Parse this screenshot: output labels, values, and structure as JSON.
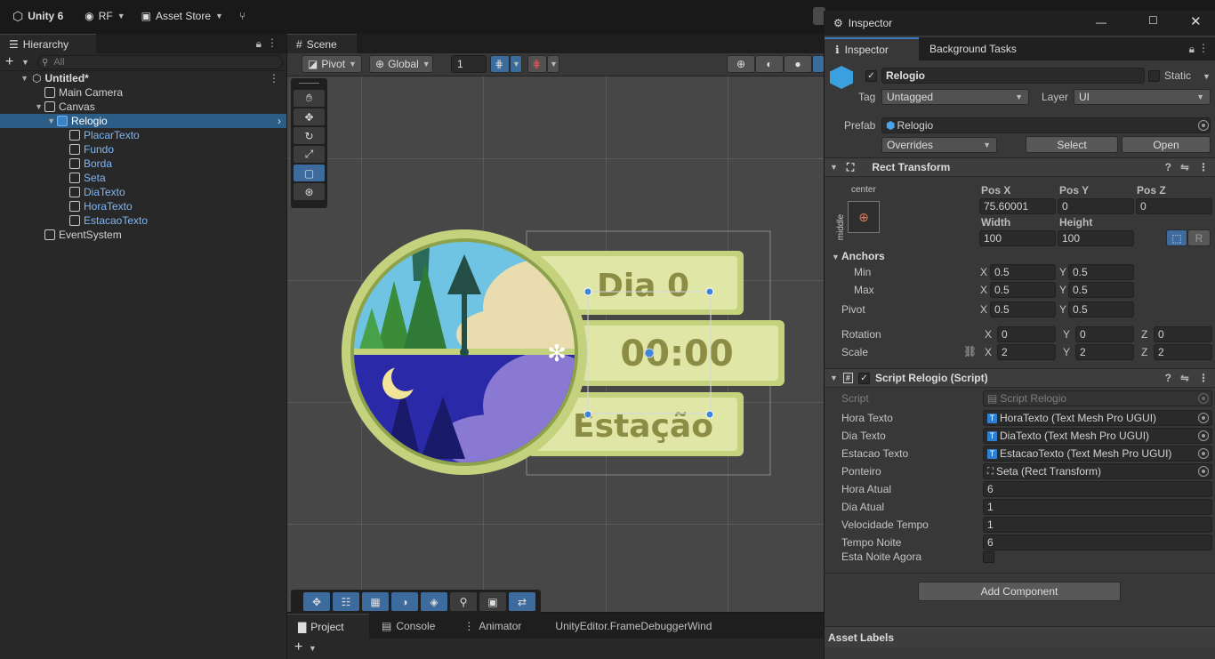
{
  "topbar": {
    "app": "Unity 6",
    "account": "RF",
    "asset_store": "Asset Store"
  },
  "hierarchy": {
    "tab": "Hierarchy",
    "search_placeholder": "All",
    "scene": "Untitled*",
    "items": [
      {
        "name": "Main Camera",
        "depth": 1,
        "prefab": false
      },
      {
        "name": "Canvas",
        "depth": 1,
        "prefab": false,
        "expanded": true
      },
      {
        "name": "Relogio",
        "depth": 2,
        "prefab": true,
        "selected": true
      },
      {
        "name": "PlacarTexto",
        "depth": 3,
        "prefab": true
      },
      {
        "name": "Fundo",
        "depth": 3,
        "prefab": true
      },
      {
        "name": "Borda",
        "depth": 3,
        "prefab": true
      },
      {
        "name": "Seta",
        "depth": 3,
        "prefab": true
      },
      {
        "name": "DiaTexto",
        "depth": 3,
        "prefab": true
      },
      {
        "name": "HoraTexto",
        "depth": 3,
        "prefab": true
      },
      {
        "name": "EstacaoTexto",
        "depth": 3,
        "prefab": true
      },
      {
        "name": "EventSystem",
        "depth": 1,
        "prefab": false
      }
    ]
  },
  "scene": {
    "tab": "Scene",
    "pivot": "Pivot",
    "global": "Global",
    "grid_size": "1",
    "clock": {
      "day": "Dia 0",
      "time": "00:00",
      "season": "Estação"
    }
  },
  "bottom_tabs": [
    "Project",
    "Console",
    "Animator",
    "UnityEditor.FrameDebuggerWind"
  ],
  "inspector": {
    "window_title": "Inspector",
    "tabs": [
      "Inspector",
      "Background Tasks"
    ],
    "object_name": "Relogio",
    "static_label": "Static",
    "tag_label": "Tag",
    "tag_value": "Untagged",
    "layer_label": "Layer",
    "layer_value": "UI",
    "prefab_label": "Prefab",
    "prefab_value": "Relogio",
    "overrides": "Overrides",
    "select": "Select",
    "open": "Open",
    "rect_transform": {
      "title": "Rect Transform",
      "anchor_h": "center",
      "anchor_v": "middle",
      "pos_x_label": "Pos X",
      "pos_x": "75.60001",
      "pos_y_label": "Pos Y",
      "pos_y": "0",
      "pos_z_label": "Pos Z",
      "pos_z": "0",
      "width_label": "Width",
      "width": "100",
      "height_label": "Height",
      "height": "100",
      "r_label": "R",
      "anchors_label": "Anchors",
      "min_label": "Min",
      "min_x": "0.5",
      "min_y": "0.5",
      "max_label": "Max",
      "max_x": "0.5",
      "max_y": "0.5",
      "pivot_label": "Pivot",
      "pivot_x": "0.5",
      "pivot_y": "0.5",
      "rotation_label": "Rotation",
      "rot_x": "0",
      "rot_y": "0",
      "rot_z": "0",
      "scale_label": "Scale",
      "scale_x": "2",
      "scale_y": "2",
      "scale_z": "2"
    },
    "script": {
      "title": "Script Relogio (Script)",
      "script_label": "Script",
      "script_value": "Script Relogio",
      "fields": [
        {
          "label": "Hora Texto",
          "value": "HoraTexto (Text Mesh Pro UGUI)",
          "type": "tmp"
        },
        {
          "label": "Dia Texto",
          "value": "DiaTexto (Text Mesh Pro UGUI)",
          "type": "tmp"
        },
        {
          "label": "Estacao Texto",
          "value": "EstacaoTexto (Text Mesh Pro UGUI)",
          "type": "tmp"
        },
        {
          "label": "Ponteiro",
          "value": "Seta (Rect Transform)",
          "type": "rect"
        },
        {
          "label": "Hora Atual",
          "value": "6",
          "type": "num"
        },
        {
          "label": "Dia Atual",
          "value": "1",
          "type": "num"
        },
        {
          "label": "Velocidade Tempo",
          "value": "1",
          "type": "num"
        },
        {
          "label": "Tempo Noite",
          "value": "6",
          "type": "num"
        }
      ],
      "toggle_label": "Esta Noite Agora"
    },
    "add_component": "Add Component",
    "asset_labels": "Asset Labels"
  }
}
